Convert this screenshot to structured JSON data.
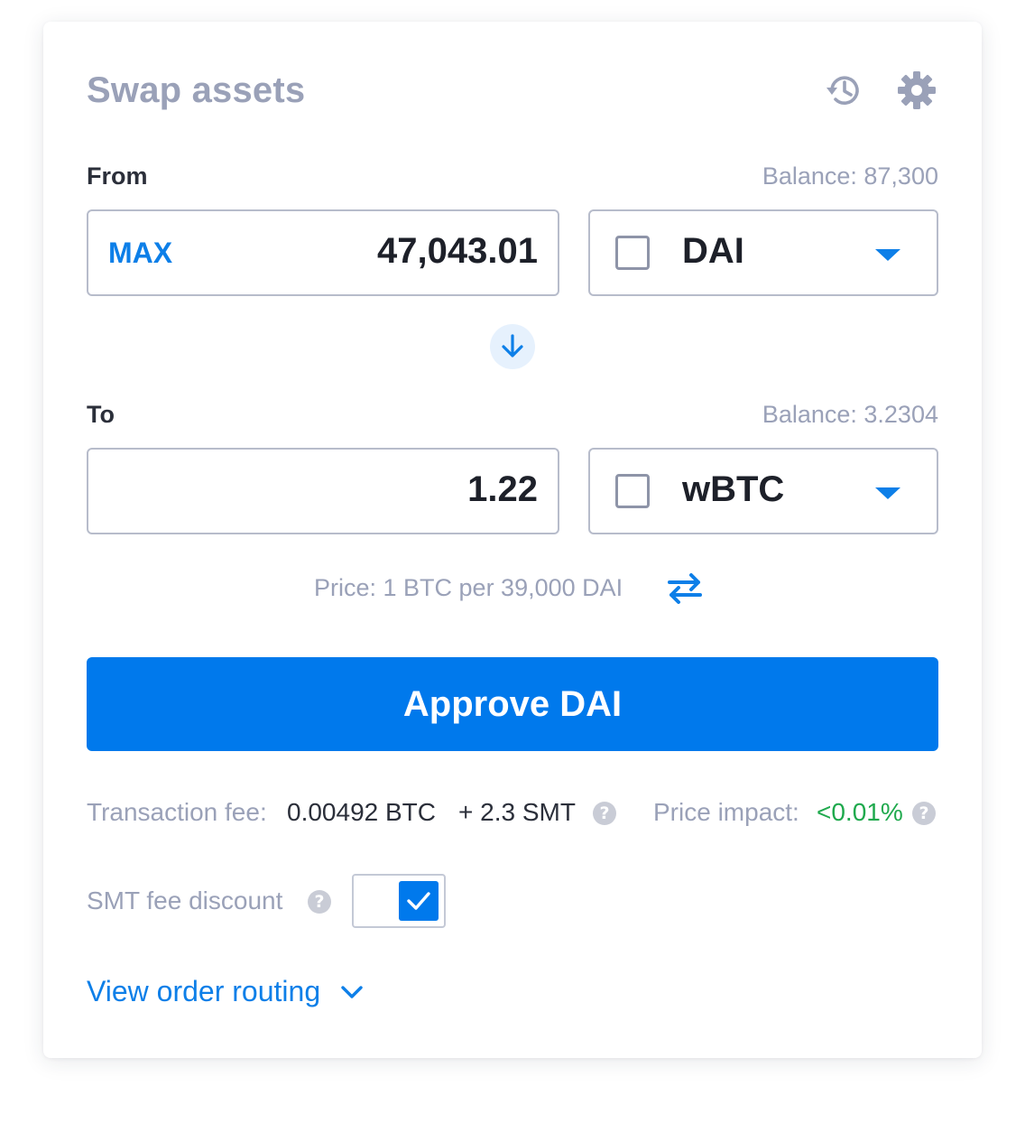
{
  "header": {
    "title": "Swap assets",
    "history_icon": "history-icon",
    "settings_icon": "gear-icon"
  },
  "from": {
    "label": "From",
    "balance": "Balance: 87,300",
    "max_label": "MAX",
    "amount": "47,043.01",
    "token": "DAI"
  },
  "to": {
    "label": "To",
    "balance": "Balance: 3.2304",
    "amount": "1.22",
    "token": "wBTC"
  },
  "price": {
    "text": "Price: 1 BTC per 39,000 DAI"
  },
  "approve_label": "Approve DAI",
  "fees": {
    "tx_fee_label": "Transaction fee:",
    "tx_fee_btc": "0.00492 BTC",
    "tx_fee_smt": "+ 2.3 SMT",
    "impact_label": "Price impact:",
    "impact_value": "<0.01%"
  },
  "discount": {
    "label": "SMT fee discount",
    "checked": true
  },
  "routing_label": "View order routing",
  "colors": {
    "accent": "#0079ec",
    "muted": "#9aa1b8",
    "positive": "#1fa94d"
  }
}
